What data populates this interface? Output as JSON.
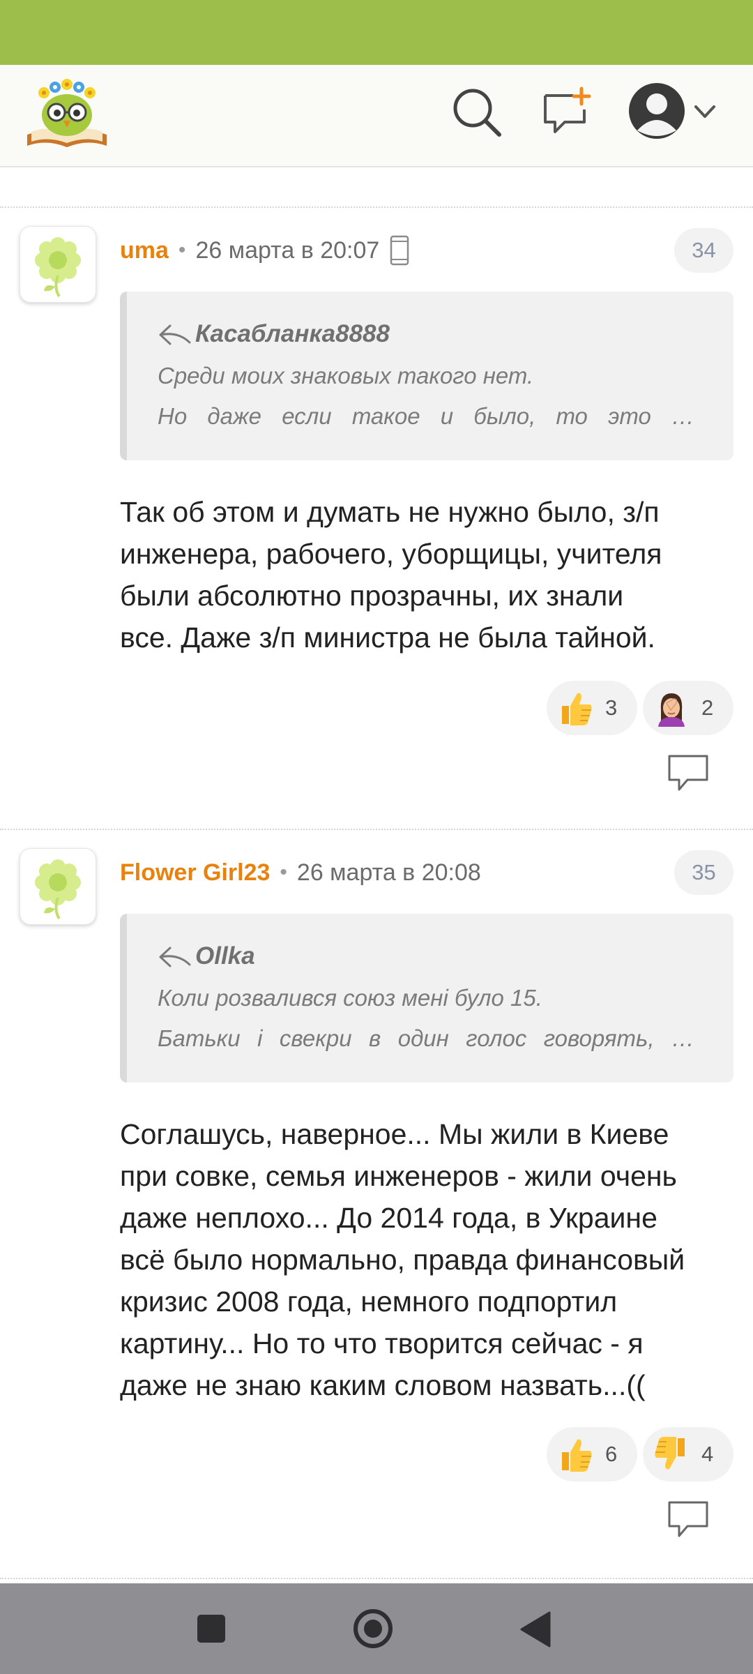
{
  "header": {
    "logo": "owl-reading-book-logo",
    "icons": [
      "search-icon",
      "new-post-icon",
      "user-avatar-icon",
      "chevron-down-icon"
    ],
    "accent_color": "#9dbe4a"
  },
  "comments": [
    {
      "author": "uma",
      "dot": "•",
      "date": "26 марта в 20:07",
      "device_icon": "mobile-phone-icon",
      "number": "34",
      "quote": {
        "author": "Касабланка8888",
        "line1": "Среди моих знаковых такого нет.",
        "line2": [
          "Но",
          "даже",
          "если",
          "такое",
          "и",
          "было,",
          "то",
          "это",
          "…"
        ]
      },
      "text": "Так об этом и думать не нужно было, з/п\nинженера, рабочего, уборщицы, учителя\nбыли абсолютно прозрачны, их знали\nвсе. Даже з/п министра не была тайной.",
      "reactions": [
        {
          "icon": "thumbs-up-icon",
          "count": "3"
        },
        {
          "icon": "facepalm-icon",
          "count": "2"
        }
      ]
    },
    {
      "author": "Flower Girl23",
      "dot": "•",
      "date": "26 марта в 20:08",
      "number": "35",
      "quote": {
        "author": "Ollka",
        "line1": "Коли розвалився союз мені було 15.",
        "line2": [
          "Батьки",
          "і",
          "свекри",
          "в",
          "один",
          "голос",
          "говорять,",
          "…"
        ]
      },
      "text": "Соглашусь, наверное... Мы жили в Киеве\nпри совке, семья инженеров - жили очень\nдаже неплохо... До 2014 года, в Украине\nвсё было нормально, правда финансовый\nкризис 2008 года, немного подпортил\nкартину... Но то что творится сейчас - я\nдаже не знаю каким словом назвать...((",
      "reactions": [
        {
          "icon": "thumbs-up-icon",
          "count": "6"
        },
        {
          "icon": "thumbs-down-icon",
          "count": "4"
        }
      ]
    }
  ],
  "navbar": {
    "buttons": [
      "recent-apps-icon",
      "home-icon",
      "back-icon"
    ],
    "color": "#8f8f93"
  }
}
